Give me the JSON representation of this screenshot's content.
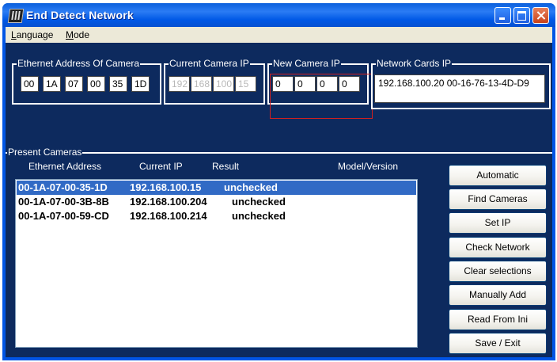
{
  "window": {
    "title": "End Detect Network"
  },
  "menu": [
    {
      "label": "Language",
      "mnemonic": "L",
      "rest": "anguage"
    },
    {
      "label": "Mode",
      "mnemonic": "M",
      "rest": "ode"
    }
  ],
  "groups": {
    "ethernet": {
      "label": "Ethernet Address Of Camera",
      "values": [
        "00",
        "1A",
        "07",
        "00",
        "35",
        "1D"
      ]
    },
    "current_ip": {
      "label": "Current Camera IP",
      "values": [
        "192",
        "168",
        "100",
        "15"
      ]
    },
    "new_ip": {
      "label": "New Camera IP",
      "values": [
        "0",
        "0",
        "0",
        "0"
      ]
    },
    "network_cards": {
      "label": "Network Cards IP",
      "value": "192.168.100.20  00-16-76-13-4D-D9"
    }
  },
  "present": {
    "label": "Present Cameras",
    "columns": [
      "Ethernet Address",
      "Current IP",
      "Result",
      "Model/Version"
    ],
    "rows": [
      {
        "mac": "00-1A-07-00-35-1D",
        "ip": "192.168.100.15",
        "result": "unchecked",
        "selected": true
      },
      {
        "mac": "00-1A-07-00-3B-8B",
        "ip": "192.168.100.204",
        "result": "unchecked",
        "selected": false
      },
      {
        "mac": "00-1A-07-00-59-CD",
        "ip": "192.168.100.214",
        "result": "unchecked",
        "selected": false
      }
    ]
  },
  "buttons": [
    "Automatic",
    "Find Cameras",
    "Set IP",
    "Check Network",
    "Clear selections",
    "Manually Add",
    "Read From Ini",
    "Save / Exit"
  ],
  "colors": {
    "title_blue": "#0058e6",
    "client_bg": "#0d2a5e",
    "selection": "#316ac5",
    "highlight_box": "#d02020"
  }
}
